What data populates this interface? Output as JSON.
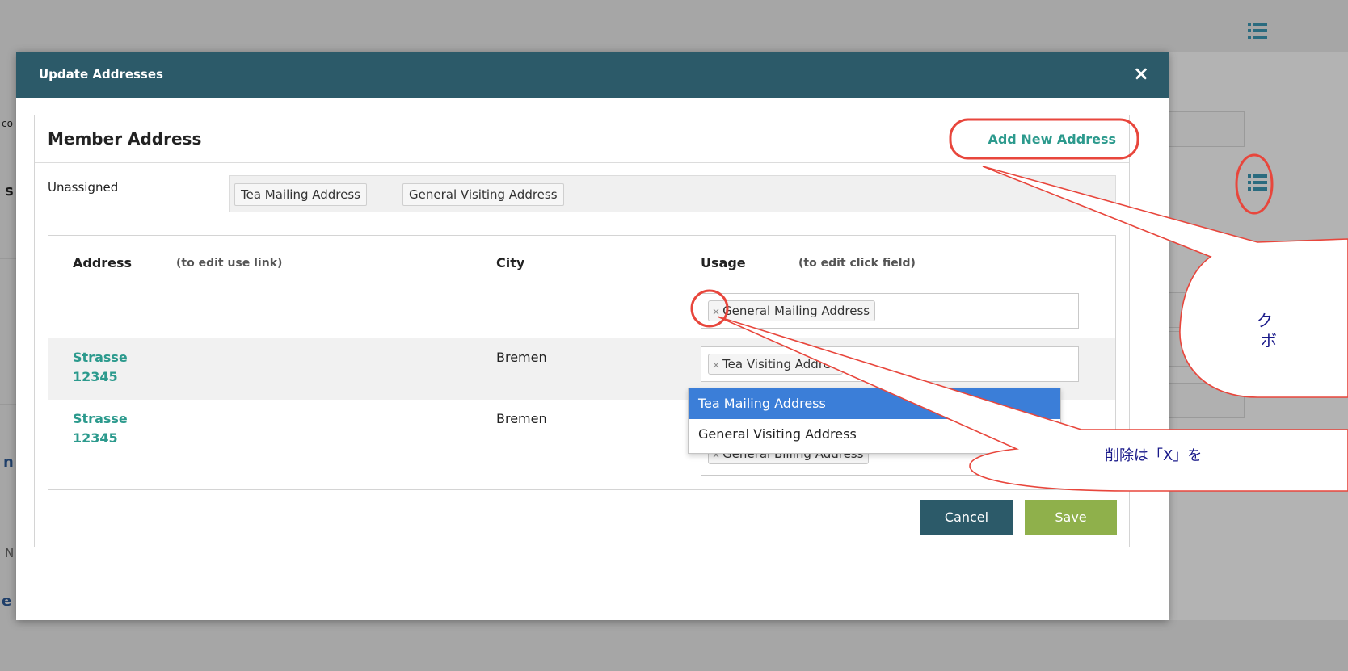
{
  "modal": {
    "title": "Update Addresses",
    "close_label": "×"
  },
  "panel": {
    "title": "Member Address",
    "add_link": "Add New Address"
  },
  "unassigned": {
    "label": "Unassigned",
    "chips": [
      "Tea Mailing Address",
      "General Visiting Address"
    ]
  },
  "table": {
    "headers": {
      "address": "Address",
      "address_hint": "(to edit use link)",
      "city": "City",
      "usage": "Usage",
      "usage_hint": "(to edit click field)"
    },
    "rows": [
      {
        "address_line1": "",
        "address_line2": "",
        "city": "",
        "usage_tag": "General Mailing Address"
      },
      {
        "address_line1": "Strasse",
        "address_line2": "12345",
        "city": "Bremen",
        "usage_tag": "Tea Visiting Addres"
      },
      {
        "address_line1": "Strasse",
        "address_line2": "12345",
        "city": "Bremen",
        "usage_tag": "General Billing Address"
      }
    ]
  },
  "dropdown": {
    "options": [
      "Tea Mailing Address",
      "General Visiting Address"
    ],
    "highlighted": "Tea Mailing Address"
  },
  "buttons": {
    "cancel": "Cancel",
    "save": "Save"
  },
  "annotations": {
    "callout1_line1": "ク",
    "callout1_line2": "ボ",
    "callout2": "削除は「X」を"
  },
  "colors": {
    "header": "#2c5a69",
    "link": "#2c9a8d",
    "save": "#8fb04b",
    "highlight": "#3b7ed8",
    "annotation": "#e8463c"
  },
  "background": {
    "fragments": [
      "s",
      "co",
      "n",
      "N",
      "e"
    ]
  }
}
